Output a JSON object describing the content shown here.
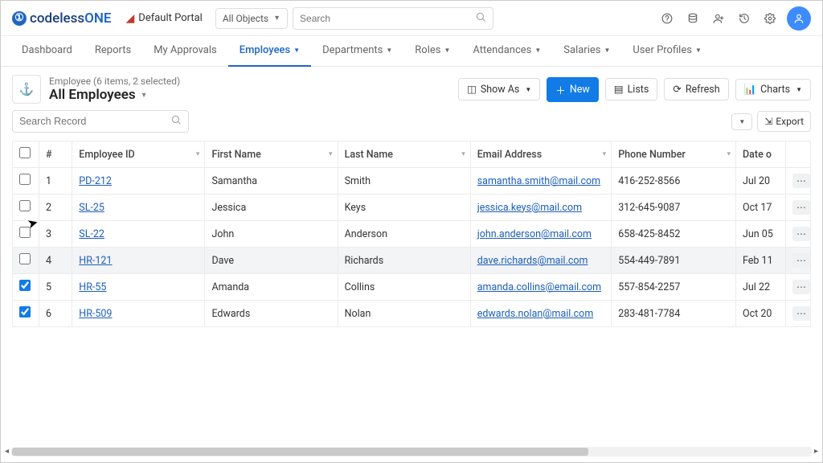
{
  "header": {
    "logo_prefix": "codeless",
    "logo_suffix": "ONE",
    "portal": "Default Portal",
    "object_selector": "All Objects",
    "search_placeholder": "Search"
  },
  "nav": {
    "items": [
      {
        "label": "Dashboard",
        "has_caret": false
      },
      {
        "label": "Reports",
        "has_caret": false
      },
      {
        "label": "My Approvals",
        "has_caret": false
      },
      {
        "label": "Employees",
        "has_caret": true,
        "active": true
      },
      {
        "label": "Departments",
        "has_caret": true
      },
      {
        "label": "Roles",
        "has_caret": true
      },
      {
        "label": "Attendances",
        "has_caret": true
      },
      {
        "label": "Salaries",
        "has_caret": true
      },
      {
        "label": "User Profiles",
        "has_caret": true
      }
    ]
  },
  "page": {
    "crumb": "Employee (6 items, 2 selected)",
    "title": "All Employees",
    "search_placeholder": "Search Record"
  },
  "actions": {
    "show_as": "Show As",
    "new": "New",
    "lists": "Lists",
    "refresh": "Refresh",
    "charts": "Charts",
    "export": "Export"
  },
  "table": {
    "columns": [
      "#",
      "Employee ID",
      "First Name",
      "Last Name",
      "Email Address",
      "Phone Number",
      "Date o"
    ],
    "col_filters": [
      false,
      true,
      true,
      true,
      true,
      true,
      false
    ],
    "rows": [
      {
        "n": "1",
        "eid": "PD-212",
        "fn": "Samantha",
        "ln": "Smith",
        "em": "samantha.smith@mail.com",
        "ph": "416-252-8566",
        "dt": "Jul 20",
        "chk": false
      },
      {
        "n": "2",
        "eid": "SL-25",
        "fn": "Jessica",
        "ln": "Keys",
        "em": "jessica.keys@mail.com",
        "ph": "312-645-9087",
        "dt": "Oct 17",
        "chk": false
      },
      {
        "n": "3",
        "eid": "SL-22",
        "fn": "John",
        "ln": "Anderson",
        "em": "john.anderson@mail.com",
        "ph": "658-425-8452",
        "dt": "Jun 05",
        "chk": false
      },
      {
        "n": "4",
        "eid": "HR-121",
        "fn": "Dave",
        "ln": "Richards",
        "em": "dave.richards@mail.com",
        "ph": "554-449-7891",
        "dt": "Feb 11",
        "chk": false,
        "hover": true
      },
      {
        "n": "5",
        "eid": "HR-55",
        "fn": "Amanda",
        "ln": "Collins",
        "em": "amanda.collins@email.com",
        "ph": "557-854-2257",
        "dt": "Jul 22",
        "chk": true
      },
      {
        "n": "6",
        "eid": "HR-509",
        "fn": "Edwards",
        "ln": "Nolan",
        "em": "edwards.nolan@mail.com",
        "ph": "283-481-7784",
        "dt": "Oct 20",
        "chk": true
      }
    ]
  }
}
